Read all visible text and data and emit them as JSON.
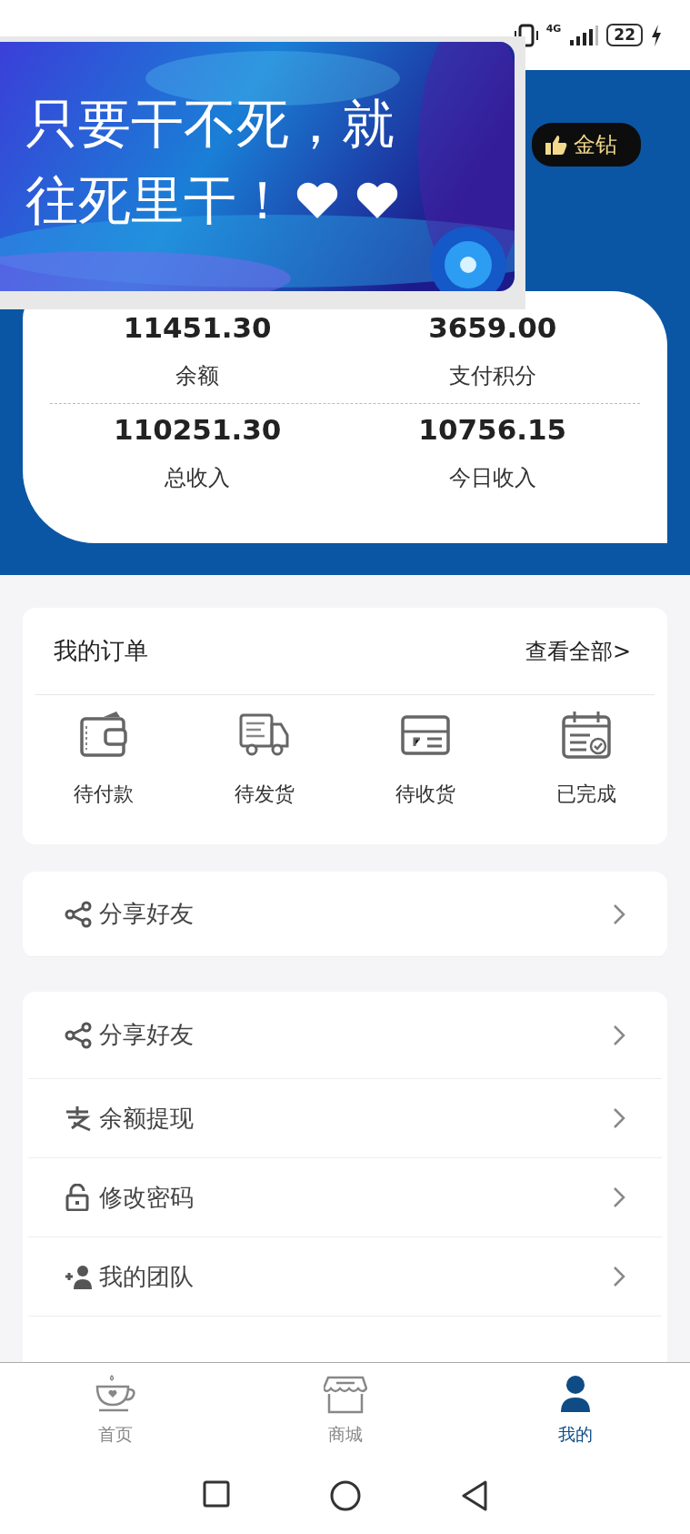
{
  "status_bar": {
    "battery": "22",
    "network": "4G"
  },
  "banner": {
    "lines": [
      "只要干不死，就",
      "往死里干！"
    ]
  },
  "header": {
    "badge": "金钻"
  },
  "stats": [
    {
      "value": "11451.30",
      "label": "余额"
    },
    {
      "value": "3659.00",
      "label": "支付积分"
    },
    {
      "value": "110251.30",
      "label": "总收入"
    },
    {
      "value": "10756.15",
      "label": "今日收入"
    }
  ],
  "orders": {
    "title": "我的订单",
    "view_all": "查看全部>",
    "items": [
      {
        "label": "待付款"
      },
      {
        "label": "待发货"
      },
      {
        "label": "待收货"
      },
      {
        "label": "已完成"
      }
    ]
  },
  "share_card": [
    {
      "label": "分享好友"
    }
  ],
  "menu": [
    {
      "label": "分享好友"
    },
    {
      "label": "余额提现"
    },
    {
      "label": "修改密码"
    },
    {
      "label": "我的团队"
    }
  ],
  "tab_bar": [
    {
      "label": "首页",
      "selected": false
    },
    {
      "label": "商城",
      "selected": false
    },
    {
      "label": "我的",
      "selected": true
    }
  ]
}
